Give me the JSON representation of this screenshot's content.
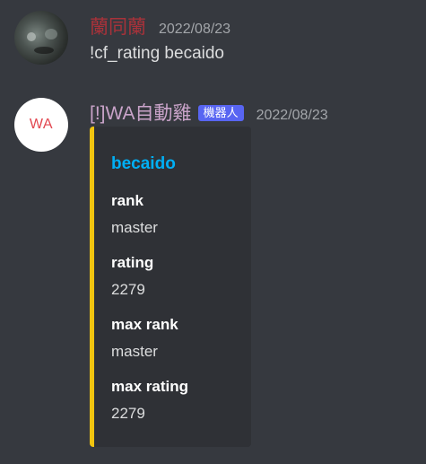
{
  "messages": [
    {
      "author": "蘭同蘭",
      "author_color": "#a8323a",
      "timestamp": "2022/08/23",
      "content": "!cf_rating becaido"
    },
    {
      "author": "[!]WA自動雞",
      "author_color": "#c9a3c9",
      "bot_tag": "機器人",
      "timestamp": "2022/08/23",
      "avatar_text": "WA",
      "embed": {
        "accent_color": "#f1c40f",
        "title": "becaido",
        "fields": [
          {
            "name": "rank",
            "value": "master"
          },
          {
            "name": "rating",
            "value": "2279"
          },
          {
            "name": "max rank",
            "value": "master"
          },
          {
            "name": "max rating",
            "value": "2279"
          }
        ]
      }
    }
  ]
}
